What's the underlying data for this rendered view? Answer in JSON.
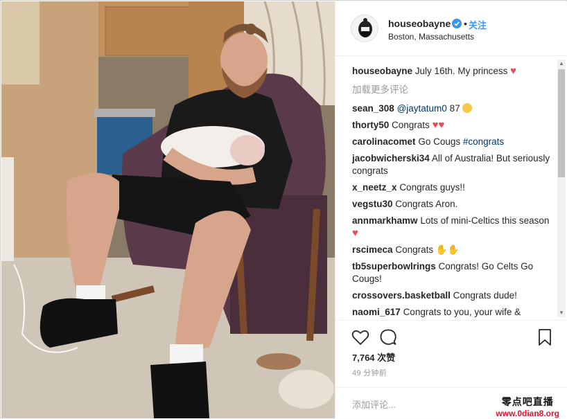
{
  "post": {
    "username": "houseobayne",
    "follow_label": "关注",
    "dot": "•",
    "location": "Boston, Massachusetts"
  },
  "caption": {
    "username": "houseobayne",
    "text": "July 16th. My princess"
  },
  "load_more": "加载更多评论",
  "comments": [
    {
      "user": "sean_308",
      "mention": "@jaytatum0",
      "text": "87"
    },
    {
      "user": "thorty50",
      "text": "Congrats"
    },
    {
      "user": "carolinacomet",
      "text": "Go Cougs",
      "tag": "#congrats"
    },
    {
      "user": "jacobwicherski34",
      "text": "All of Australia! But seriously congrats"
    },
    {
      "user": "x_neetz_x",
      "text": "Congrats guys!!"
    },
    {
      "user": "vegstu30",
      "text": "Congrats Aron."
    },
    {
      "user": "annmarkhamw",
      "text": "Lots of mini-Celtics this season"
    },
    {
      "user": "rscimeca",
      "text": "Congrats"
    },
    {
      "user": "tb5superbowlrings",
      "text": "Congrats! Go Celts Go Cougs!"
    },
    {
      "user": "crossovers.basketball",
      "text": "Congrats dude!"
    },
    {
      "user": "naomi_617",
      "text": "Congrats to you, your wife &"
    }
  ],
  "likes": "7,764 次赞",
  "time_ago": "49 分钟前",
  "add_comment_placeholder": "添加评论...",
  "watermark": {
    "line1": "零点吧直播",
    "line2": "www.0dian8.org"
  },
  "colors": {
    "link": "#3897f0",
    "heart": "#ed4956",
    "mention": "#003569"
  }
}
